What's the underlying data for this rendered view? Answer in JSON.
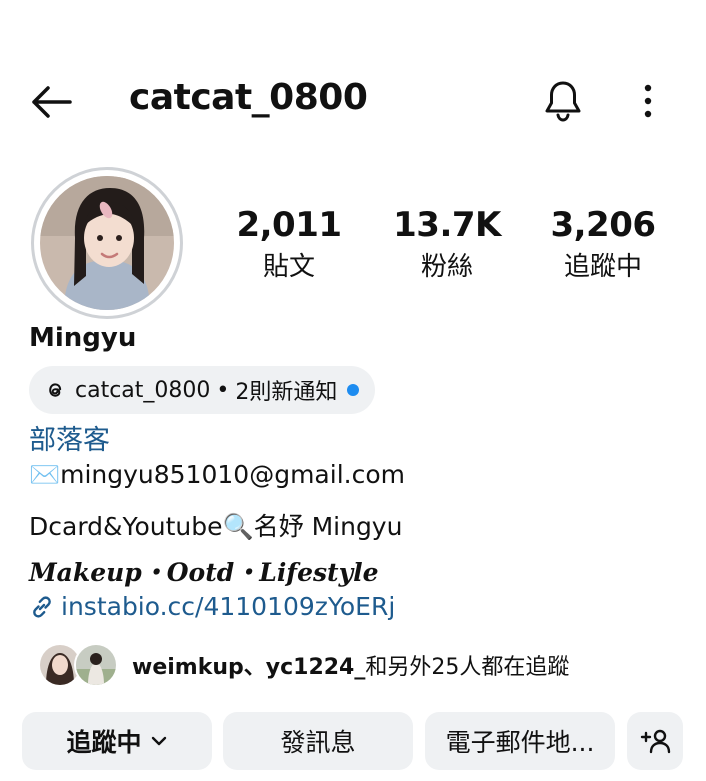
{
  "header": {
    "username": "catcat_0800",
    "icons": {
      "back": "back-arrow-icon",
      "bell": "bell-icon",
      "more": "more-vertical-icon"
    }
  },
  "stats": {
    "posts": {
      "value": "2,011",
      "label": "貼文"
    },
    "followers": {
      "value": "13.7K",
      "label": "粉絲"
    },
    "following": {
      "value": "3,206",
      "label": "追蹤中"
    }
  },
  "profile": {
    "display_name": "Mingyu",
    "threads": {
      "name": "catcat_0800",
      "separator": "•",
      "notification": "2則新通知",
      "icon": "threads-icon"
    },
    "category": "部落客",
    "bio": {
      "email_line": "✉️mingyu851010@gmail.com",
      "dcard_line": "Dcard&Youtube🔍名妤 Mingyu",
      "tagline": "Makeup・Ootd・Lifestyle",
      "link": "instabio.cc/4110109zYoERj"
    },
    "mutual": {
      "names": "weimkup、yc1224_",
      "rest": "和另外25人都在追蹤"
    }
  },
  "actions": {
    "following": "追蹤中",
    "message": "發訊息",
    "email": "電子郵件地..."
  },
  "colors": {
    "accent_blue": "#1e5b8e",
    "notif_dot": "#1d8cf0",
    "button_bg": "#eff1f3"
  }
}
